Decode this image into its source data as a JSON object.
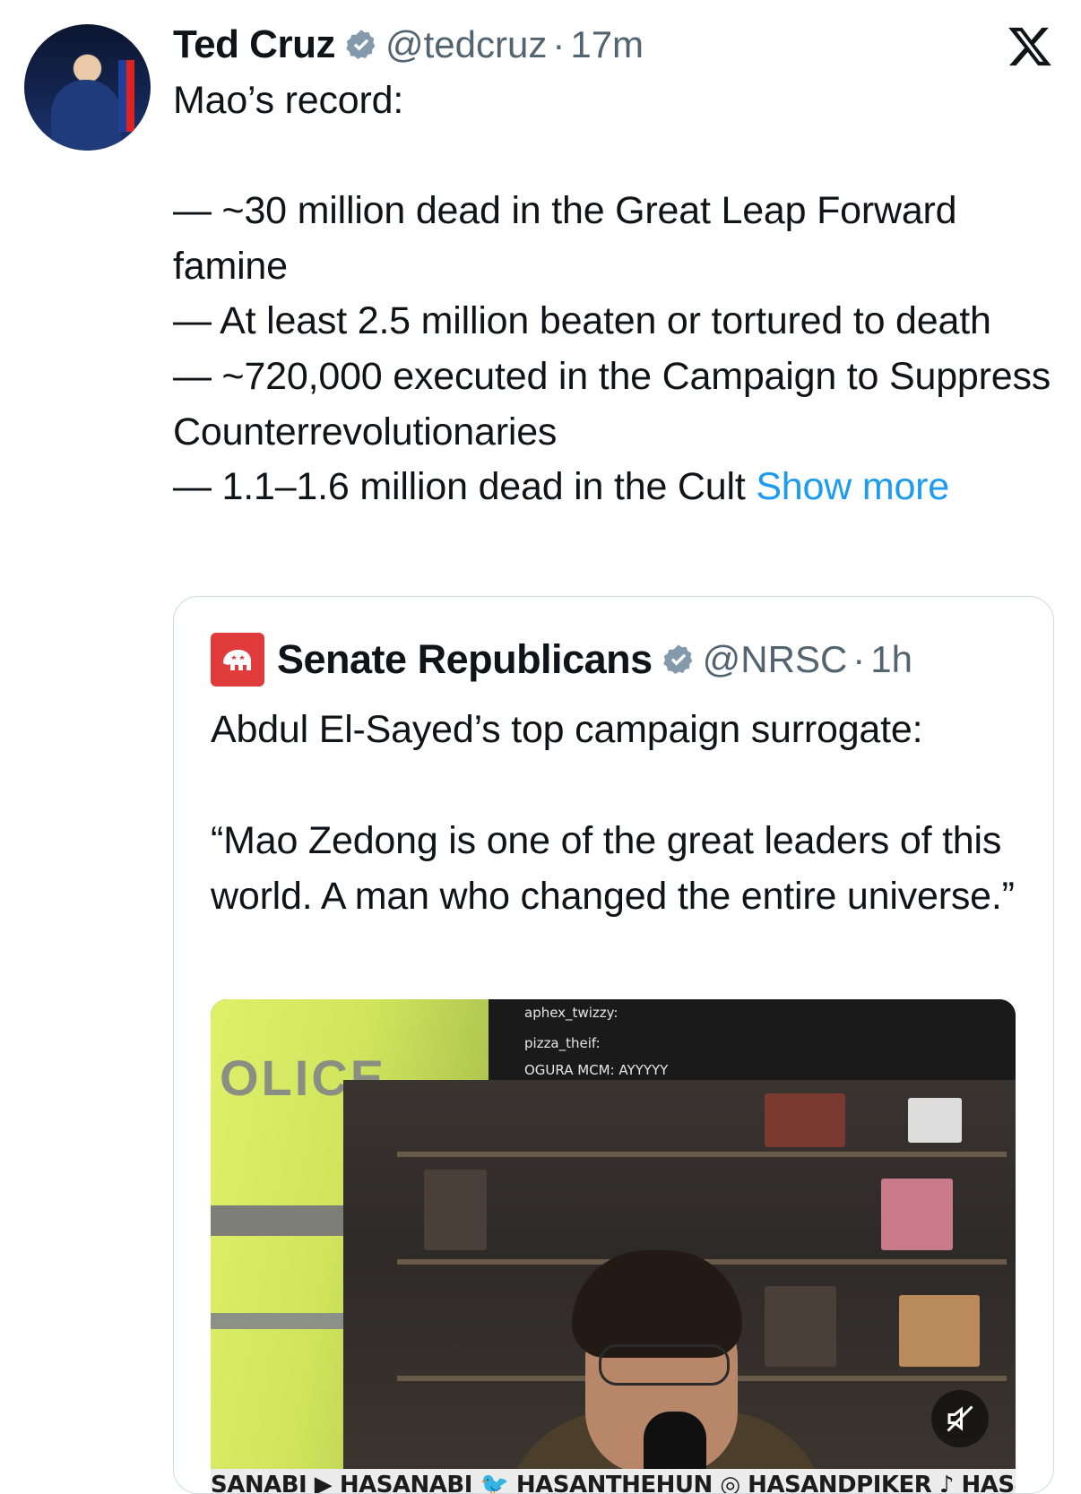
{
  "tweet": {
    "author_name": "Ted Cruz",
    "handle": "@tedcruz",
    "separator": "·",
    "time": "17m",
    "text": "Mao’s record:\n\n— ~30 million dead in the Great Leap Forward famine\n— At least 2.5 million beaten or tortured to death\n— ~720,000 executed in the Campaign to Suppress Counterrevolutionaries\n— 1.1–1.6 million dead in the Cult ",
    "show_more": "Show more"
  },
  "quoted": {
    "author_name": "Senate Republicans",
    "handle": "@NRSC",
    "separator": "·",
    "time": "1h",
    "text": "Abdul El-Sayed’s top campaign surrogate:\n\n“Mao Zedong is one of the great leaders of this world. A man who changed the entire universe.”",
    "video": {
      "overlay_left_text": "OLICE",
      "chat": [
        "aphex_twizzy:",
        "pizza_theif:",
        "OGURA MCM: AYYYYY"
      ],
      "banner": "SANABI ▶ HASANABI 🐦 HASANTHEHUN ◎ HASANDPIKER ♪ HASANDPIKER"
    }
  },
  "colors": {
    "link": "#1d9bf0",
    "secondary_text": "#536471",
    "verified_badge": "#829aab",
    "nrsc_red": "#e03a3a"
  },
  "icons": [
    "verified-badge-icon",
    "x-logo-icon",
    "elephant-icon",
    "mute-icon"
  ]
}
